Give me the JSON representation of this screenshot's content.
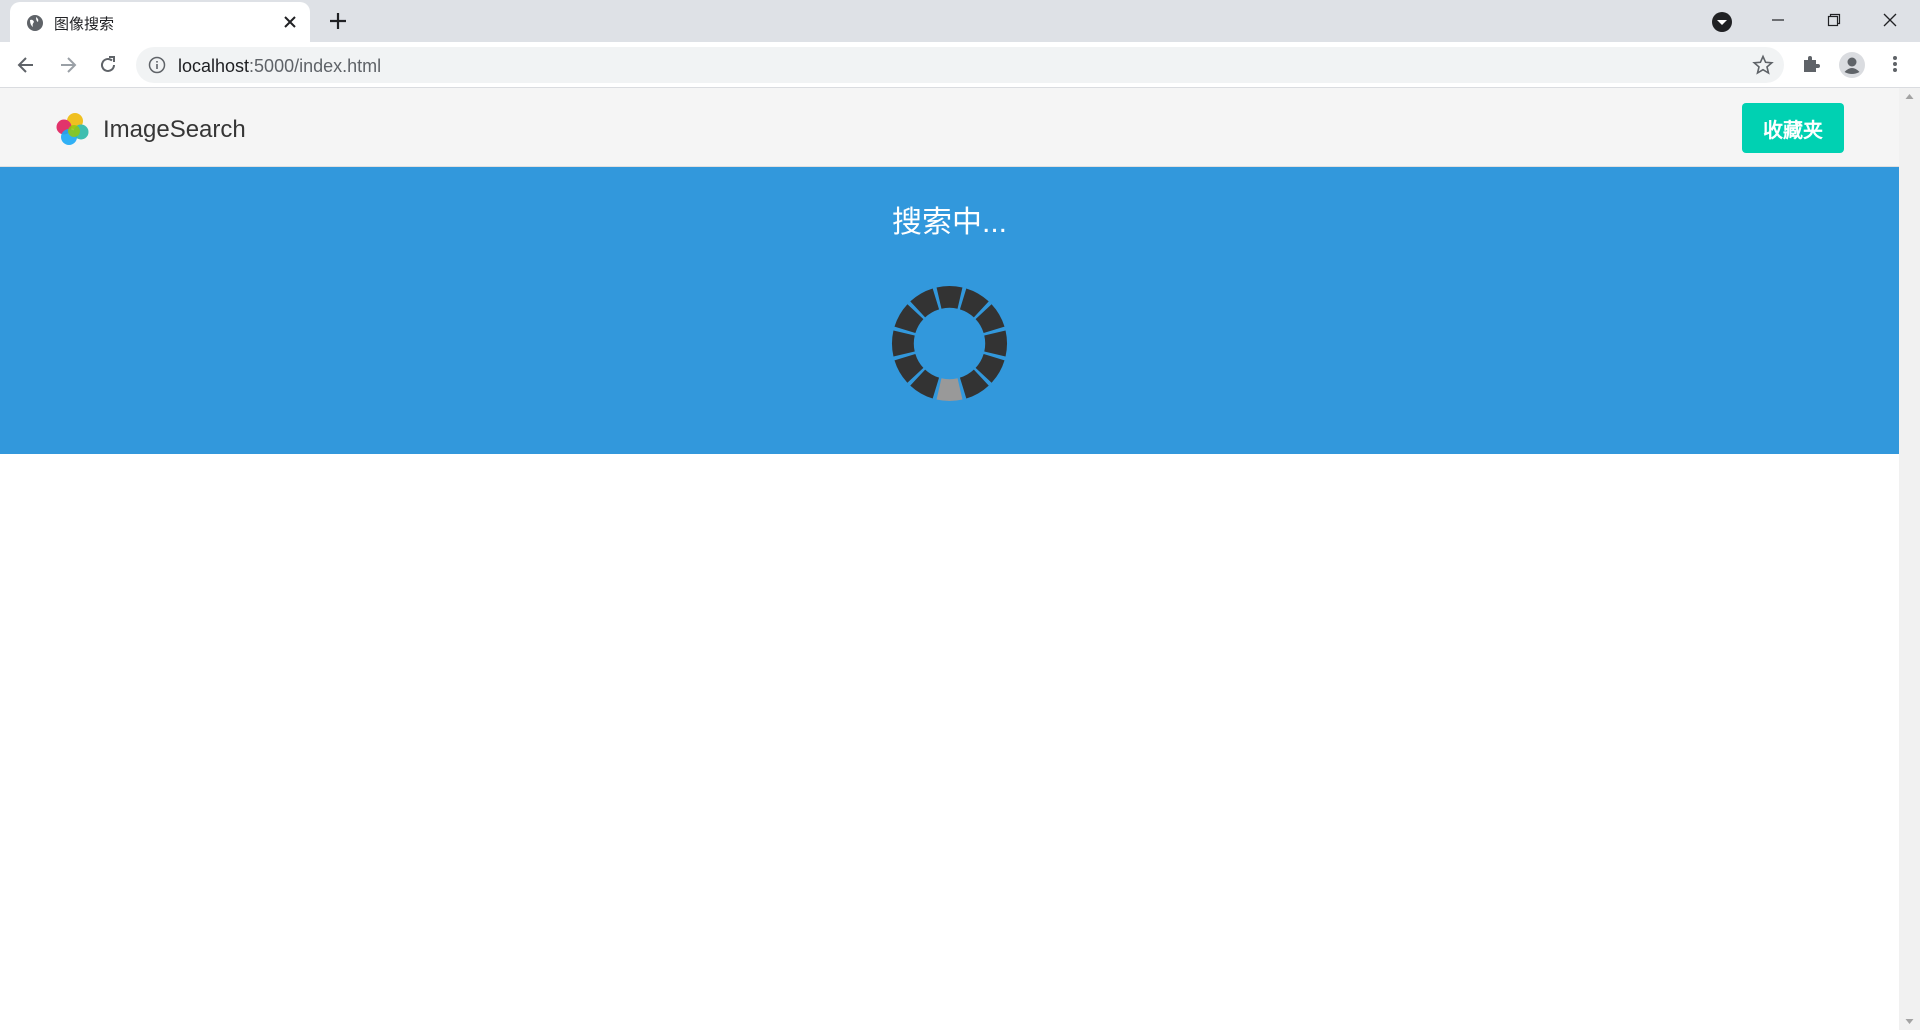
{
  "browser": {
    "tab_title": "图像搜索",
    "url_host": "localhost",
    "url_rest": ":5000/index.html"
  },
  "navbar": {
    "brand": "ImageSearch",
    "favorites_label": "收藏夹"
  },
  "hero": {
    "status_text": "搜索中..."
  },
  "colors": {
    "hero_bg": "#3298dc",
    "button_bg": "#00d1b2",
    "spinner_segment": "#333333",
    "spinner_active": "#999999"
  },
  "spinner": {
    "segments": 12,
    "active_segment": 6
  }
}
